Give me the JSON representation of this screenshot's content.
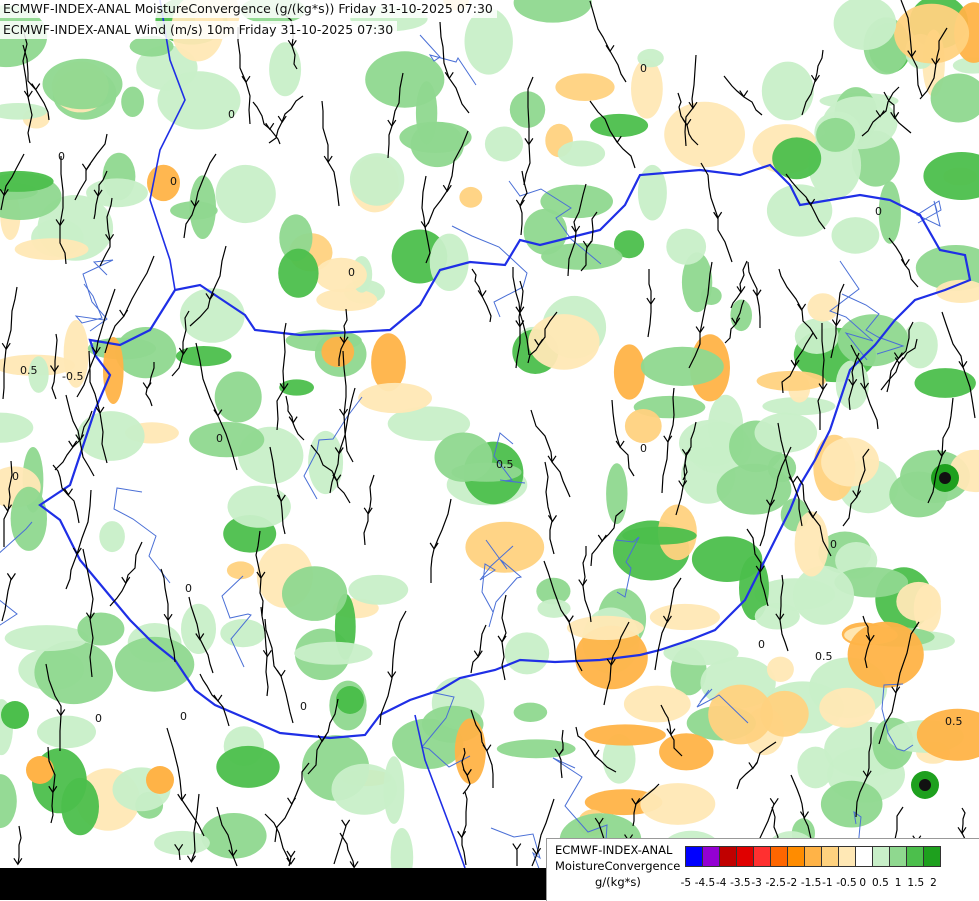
{
  "titles": {
    "line1": "ECMWF-INDEX-ANAL MoistureConvergence (g/(kg*s)) Friday 31-10-2025 07:30",
    "line2": "ECMWF-INDEX-ANAL Wind (m/s) 10m Friday 31-10-2025 07:30"
  },
  "legend": {
    "line1": "ECMWF-INDEX-ANAL",
    "line2": "MoistureConvergence",
    "line3": "g/(kg*s)",
    "tick_labels": [
      "-5",
      "-4.5",
      "-4",
      "-3.5",
      "-3",
      "-2.5",
      "-2",
      "-1.5",
      "-1",
      "-0.5",
      "0",
      "0.5",
      "1",
      "1.5",
      "2"
    ],
    "colors": [
      "#0000ff",
      "#9400d3",
      "#c00000",
      "#e00000",
      "#ff3030",
      "#ff6600",
      "#ff8c00",
      "#ffb347",
      "#ffd27f",
      "#ffe8b5",
      "#ffffff",
      "#c8efc8",
      "#8fd88f",
      "#4cbf4c",
      "#1ea01e"
    ]
  },
  "contour_labels": [
    "0",
    "0.5",
    "-0.5"
  ],
  "colors": {
    "border": "#1f2fe6",
    "river": "#4a6fd6",
    "streamline": "#000000"
  }
}
